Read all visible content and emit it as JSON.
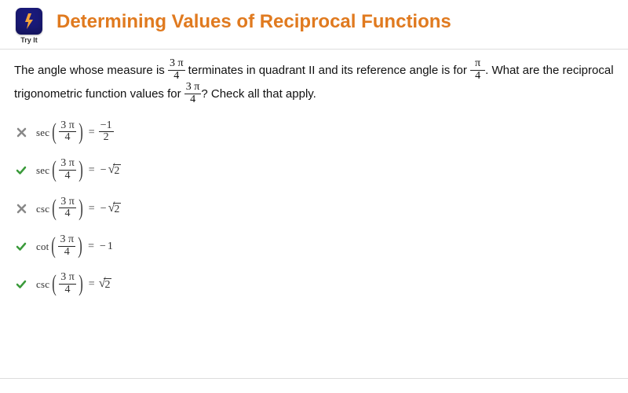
{
  "header": {
    "tryit_label": "Try It",
    "title": "Determining Values of Reciprocal Functions"
  },
  "question": {
    "part1": "The angle whose measure is ",
    "frac1_num": "3 π",
    "frac1_den": "4",
    "part2": " terminates in quadrant II and its reference angle is for ",
    "frac2_num": "π",
    "frac2_den": "4",
    "part3": ". What are the reciprocal",
    "part4": "trigonometric function values for ",
    "frac3_num": "3 π",
    "frac3_den": "4",
    "part5": "? Check all that apply."
  },
  "arg": {
    "num": "3 π",
    "den": "4"
  },
  "options": [
    {
      "mark": "wrong",
      "fn": "sec",
      "rhs_type": "frac",
      "rhs_num": "−1",
      "rhs_den": "2"
    },
    {
      "mark": "correct",
      "fn": "sec",
      "rhs_type": "negsqrt",
      "rhs_val": "2"
    },
    {
      "mark": "wrong",
      "fn": "csc",
      "rhs_type": "negsqrt",
      "rhs_val": "2"
    },
    {
      "mark": "correct",
      "fn": "cot",
      "rhs_type": "negnum",
      "rhs_val": "1"
    },
    {
      "mark": "correct",
      "fn": "csc",
      "rhs_type": "sqrt",
      "rhs_val": "2"
    }
  ]
}
